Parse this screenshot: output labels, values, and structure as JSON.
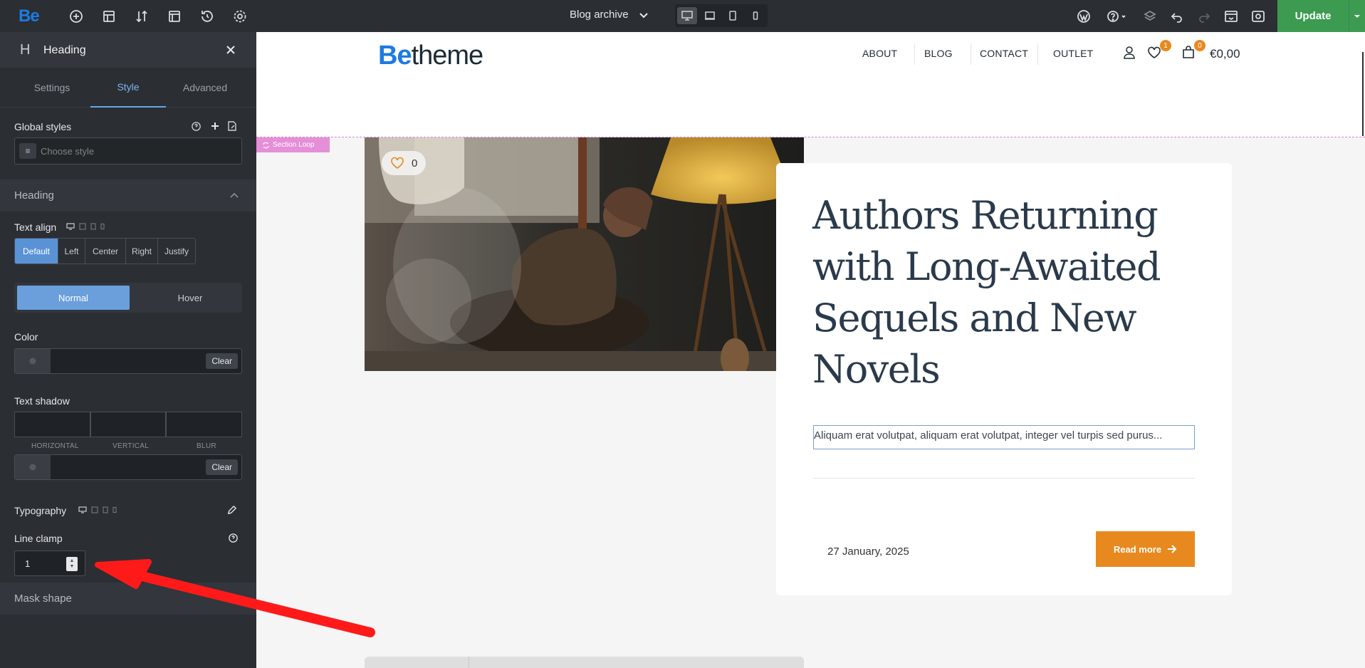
{
  "topbar": {
    "logo": "Be",
    "document_title": "Blog archive",
    "update_label": "Update",
    "active_device": "desktop"
  },
  "panel": {
    "title": "Heading",
    "title_glyph": "H",
    "tabs": [
      {
        "label": "Settings",
        "active": false
      },
      {
        "label": "Style",
        "active": true
      },
      {
        "label": "Advanced",
        "active": false
      }
    ],
    "global_styles_label": "Global styles",
    "choose_style_placeholder": "Choose style",
    "section_heading": "Heading",
    "text_align_label": "Text align",
    "align_options": [
      "Default",
      "Left",
      "Center",
      "Right",
      "Justify"
    ],
    "align_selected": "Default",
    "state_normal": "Normal",
    "state_hover": "Hover",
    "color_label": "Color",
    "clear_label": "Clear",
    "text_shadow_label": "Text shadow",
    "shadow_horizontal": "HORIZONTAL",
    "shadow_vertical": "VERTICAL",
    "shadow_blur": "BLUR",
    "typography_label": "Typography",
    "line_clamp_label": "Line clamp",
    "line_clamp_value": "1",
    "section_mask": "Mask shape"
  },
  "site": {
    "logo_be": "Be",
    "logo_theme": "theme",
    "nav": [
      "ABOUT",
      "BLOG",
      "CONTACT",
      "OUTLET"
    ],
    "wishlist_count": "1",
    "cart_count": "0",
    "cart_total": "€0,00",
    "loop_tag": "Section Loop"
  },
  "post": {
    "likes": "0",
    "title": "Authors Returning with Long-Awaited Sequels and New Novels",
    "excerpt": "Aliquam erat volutpat, aliquam erat volutpat, integer vel turpis sed purus...",
    "date": "27 January, 2025",
    "read_more": "Read more"
  },
  "colors": {
    "accent_blue": "#1d7be0",
    "update_green": "#3c9b51",
    "read_more_orange": "#e8891f",
    "loop_pink": "#e58fd8",
    "annotation_arrow": "#ff1a1a"
  }
}
